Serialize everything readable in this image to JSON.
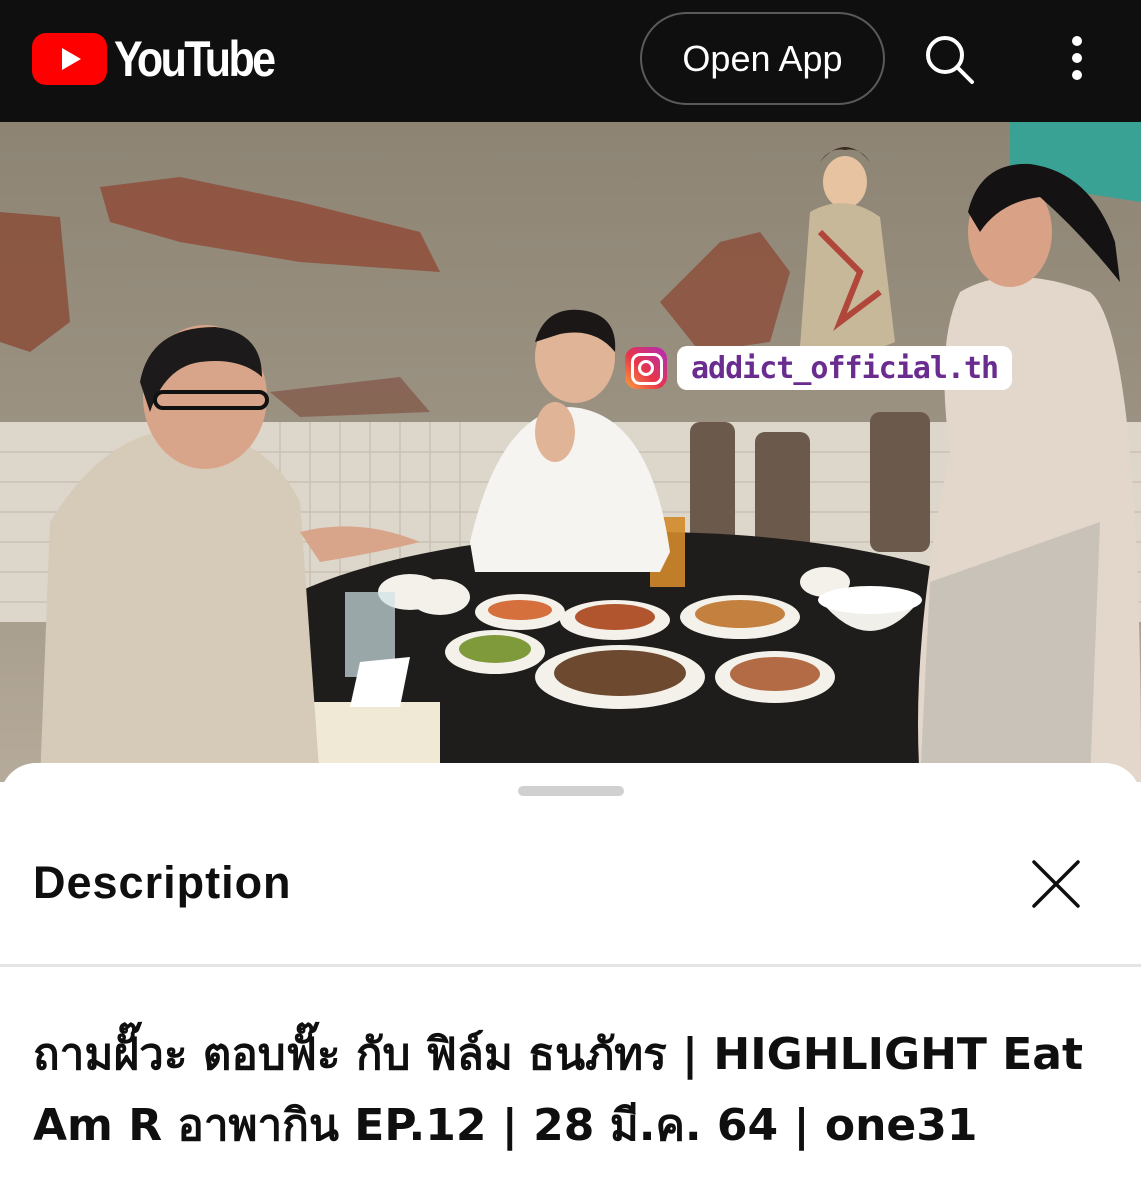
{
  "header": {
    "brand": "YouTube",
    "open_app_label": "Open App",
    "search_icon": "search-icon",
    "more_icon": "more-vertical-icon"
  },
  "video": {
    "watermark_handle": "addict_official.th",
    "watermark_icon": "instagram-icon"
  },
  "description_sheet": {
    "title": "Description",
    "close_icon": "close-icon",
    "video_title": "ถามฝั๊วะ ตอบฟั๊ะ กับ ฟิล์ม ธนภัทร | HIGHLIGHT Eat Am R อาพากิน EP.12 | 28 มี.ค. 64 | one31"
  },
  "colors": {
    "topbar_bg": "#0f0f0f",
    "brand_red": "#ff0000",
    "sheet_bg": "#ffffff",
    "text_primary": "#0f0f0f"
  }
}
